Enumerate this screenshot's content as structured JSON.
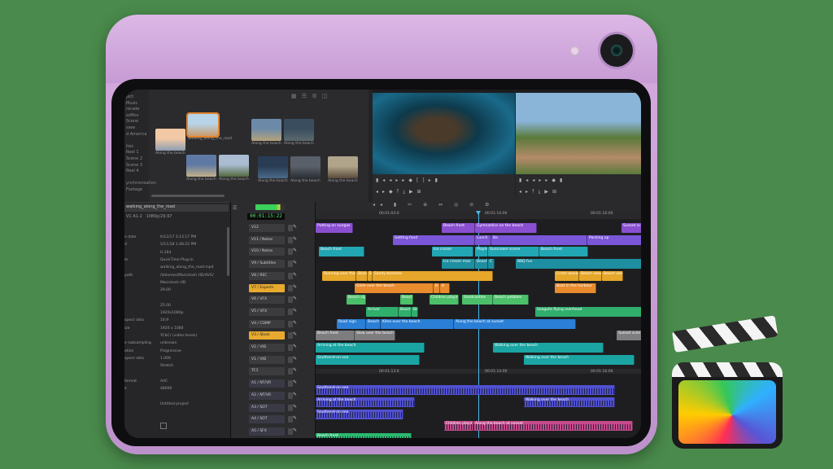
{
  "browser": {
    "bins": [
      "ject",
      "Music",
      "rerade",
      "ssMov",
      "Scene",
      "ssee",
      "d America",
      "",
      "ites",
      "Reel 1",
      "Scene 2",
      "Scene 3",
      "Reel 4",
      "",
      "ynchronization",
      "Footage"
    ],
    "clips": [
      {
        "label": "Along the beach",
        "colors": [
          "#f2c9a4",
          "#8a9db2"
        ]
      },
      {
        "label": "walking_along_the_road",
        "colors": [
          "#b8d4e8",
          "#c99a6a"
        ],
        "selected": true
      },
      {
        "label": "Along the beach",
        "colors": [
          "#6c8aa8",
          "#b5a37a"
        ]
      },
      {
        "label": "Along the beach",
        "colors": [
          "#3a4d5e",
          "#5a6a6e"
        ]
      },
      {
        "label": "Along the beach",
        "colors": [
          "#8a9ab0",
          "#5a4a3a"
        ]
      },
      {
        "label": "Along the beach",
        "colors": [
          "#5e7aa4",
          "#c4b08a"
        ]
      },
      {
        "label": "Along the beach",
        "colors": [
          "#a9bcd2",
          "#546a3e"
        ]
      },
      {
        "label": "Along the beach",
        "colors": [
          "#2a3c54",
          "#4a6a8a"
        ]
      },
      {
        "label": "Along the beach",
        "colors": [
          "#59606a",
          "#2a2e34"
        ]
      },
      {
        "label": "Along the beach",
        "colors": [
          "#b0a58a",
          "#5a4a3a"
        ]
      }
    ]
  },
  "inspector": {
    "clip_name": "walking_along_the_road",
    "subtitle": "V1 A1-2",
    "format": "1080p/29.97",
    "rows": [
      {
        "k": "n date",
        "v": "6/12/17    3:13:17 PM"
      },
      {
        "k": "d",
        "v": "5/11/18    1:48:22 PM"
      },
      {
        "k": "",
        "v": "H.264"
      },
      {
        "k": "le",
        "v": "QuickTime Plug-in"
      },
      {
        "k": "",
        "v": "walking_along_the_road.mp4"
      },
      {
        "k": "path",
        "v": "/Volumes/Macintosh HD/AVG/"
      },
      {
        "k": "",
        "v": "Macintosh HD"
      },
      {
        "k": "",
        "v": "29.00"
      },
      {
        "k": "",
        "v": ""
      },
      {
        "k": "",
        "v": "25.00"
      },
      {
        "k": "",
        "v": "1920x1080p"
      },
      {
        "k": "spect ratio",
        "v": "16:9"
      },
      {
        "k": "ize",
        "v": "1920 x 1080"
      },
      {
        "k": "",
        "v": "YCbCr (video levels)"
      },
      {
        "k": "e subsampling",
        "v": "unknown"
      },
      {
        "k": "ation",
        "v": "Progressive"
      },
      {
        "k": "spect ratio",
        "v": "1.000"
      },
      {
        "k": "",
        "v": "Stretch"
      },
      {
        "k": "",
        "v": ""
      },
      {
        "k": "format",
        "v": "AAC"
      },
      {
        "k": "e",
        "v": "48000"
      },
      {
        "k": "",
        "v": ""
      },
      {
        "k": "",
        "v": "Untitled project"
      }
    ]
  },
  "timeline": {
    "timecode": "00:01:15:22",
    "ruler_ticks": [
      "00:01:03:0",
      "00:01:14:00",
      "00:01:16:00"
    ],
    "ruler2_ticks": [
      "00:01:13:0",
      "00:01:14:00",
      "00:01:16:00"
    ],
    "tracks": [
      {
        "name": "V12",
        "hl": false
      },
      {
        "name": "V11 / Notes",
        "hl": false
      },
      {
        "name": "V10 / Notes",
        "hl": false
      },
      {
        "name": "V9 / Subtitles",
        "hl": false
      },
      {
        "name": "V8 / REC",
        "hl": false
      },
      {
        "name": "V7 / Experts",
        "hl": true
      },
      {
        "name": "V6 / VFX",
        "hl": false
      },
      {
        "name": "V5 / VFX",
        "hl": false
      },
      {
        "name": "V4 / COMP",
        "hl": false
      },
      {
        "name": "V3 / Stock",
        "hl": true
      },
      {
        "name": "V2 / VID",
        "hl": false
      },
      {
        "name": "V1 / VID",
        "hl": false
      },
      {
        "name": "TC1",
        "hl": false
      },
      {
        "name": "A1 / NT/VR",
        "hl": false,
        "audio": true
      },
      {
        "name": "A2 / NT/VR",
        "hl": false,
        "audio": true
      },
      {
        "name": "A3 / SOT",
        "hl": false,
        "audio": true
      },
      {
        "name": "A4 / SOT",
        "hl": false,
        "audio": true
      },
      {
        "name": "A5 / SFX",
        "hl": false,
        "audio": true
      }
    ],
    "lanes": [
      [
        {
          "s": 0,
          "e": 46,
          "t": "Putting on sungas",
          "c": "#8a4fd1"
        },
        {
          "s": 155,
          "e": 196,
          "t": "Beach front",
          "c": "#8a4fd1"
        },
        {
          "s": 196,
          "e": 272,
          "t": "Gymnastics on the beach",
          "c": "#8a4fd1"
        },
        {
          "s": 376,
          "e": 401,
          "t": "Sunset scre",
          "c": "#8a4fd1"
        }
      ],
      [
        {
          "s": 95,
          "e": 196,
          "t": "Getting food",
          "c": "#7a56d8"
        },
        {
          "s": 196,
          "e": 216,
          "t": "Lunch",
          "c": "#7a56d8"
        },
        {
          "s": 216,
          "e": 334,
          "t": "Ba",
          "c": "#7a56d8"
        },
        {
          "s": 334,
          "e": 401,
          "t": "Packing up",
          "c": "#7a56d8"
        }
      ],
      [
        {
          "s": 4,
          "e": 60,
          "t": "Beach front",
          "c": "#23a6b4"
        },
        {
          "s": 143,
          "e": 194,
          "t": "Ice cream",
          "c": "#23a6b4"
        },
        {
          "s": 196,
          "e": 212,
          "t": "Playing",
          "c": "#23a6b4"
        },
        {
          "s": 212,
          "e": 275,
          "t": "Suncream scene",
          "c": "#23a6b4"
        },
        {
          "s": 275,
          "e": 335,
          "t": "Beach front",
          "c": "#23a6b4"
        }
      ],
      [
        {
          "s": 155,
          "e": 196,
          "t": "Ice cream man",
          "c": "#1e8fa0"
        },
        {
          "s": 196,
          "e": 212,
          "t": "Beach",
          "c": "#1e8fa0"
        },
        {
          "s": 212,
          "e": 220,
          "t": "C",
          "c": "#1e8fa0"
        },
        {
          "s": 246,
          "e": 401,
          "t": "BBQ fun",
          "c": "#1e8fa0"
        }
      ],
      [
        {
          "s": 8,
          "e": 50,
          "t": "Running over the s",
          "c": "#e6a72a"
        },
        {
          "s": 50,
          "e": 64,
          "t": "Beach",
          "c": "#e6a72a"
        },
        {
          "s": 64,
          "e": 70,
          "t": "B",
          "c": "#e6a72a"
        },
        {
          "s": 70,
          "e": 218,
          "t": "Sandy beaches",
          "c": "#e6a72a"
        },
        {
          "s": 294,
          "e": 324,
          "t": "Crash waves",
          "c": "#e6a72a"
        },
        {
          "s": 324,
          "e": 352,
          "t": "Beach view",
          "c": "#e6a72a"
        },
        {
          "s": 352,
          "e": 378,
          "t": "Beach view",
          "c": "#e6a72a"
        }
      ],
      [
        {
          "s": 48,
          "e": 145,
          "t": "Glide over the beach",
          "c": "#e88c2e"
        },
        {
          "s": 145,
          "e": 153,
          "t": "B",
          "c": "#e88c2e"
        },
        {
          "s": 153,
          "e": 165,
          "t": "B",
          "c": "#e88c2e"
        },
        {
          "s": 294,
          "e": 345,
          "t": "Boat in the harbour",
          "c": "#e88c2e"
        }
      ],
      [
        {
          "s": 38,
          "e": 62,
          "t": "Beach sign",
          "c": "#4cbf6a"
        },
        {
          "s": 104,
          "e": 120,
          "t": "Beach",
          "c": "#4cbf6a"
        },
        {
          "s": 140,
          "e": 176,
          "t": "Children playing",
          "c": "#4cbf6a"
        },
        {
          "s": 180,
          "e": 218,
          "t": "Sandcastles",
          "c": "#4cbf6a"
        },
        {
          "s": 218,
          "e": 262,
          "t": "Beach pebbles",
          "c": "#4cbf6a"
        }
      ],
      [
        {
          "s": 62,
          "e": 102,
          "t": "Arrival",
          "c": "#2fae6c"
        },
        {
          "s": 102,
          "e": 118,
          "t": "Beach",
          "c": "#2fae6c"
        },
        {
          "s": 118,
          "e": 126,
          "t": "Be",
          "c": "#2fae6c"
        },
        {
          "s": 270,
          "e": 401,
          "t": "Seagulls flying overhead",
          "c": "#2fae6c"
        }
      ],
      [
        {
          "s": 26,
          "e": 62,
          "t": "Road sign",
          "c": "#2b7fd6"
        },
        {
          "s": 62,
          "e": 80,
          "t": "Beach",
          "c": "#2b7fd6"
        },
        {
          "s": 80,
          "e": 170,
          "t": "Kites over the beach",
          "c": "#2b7fd6"
        },
        {
          "s": 170,
          "e": 320,
          "t": "Along the beach at sunset",
          "c": "#2b7fd6"
        }
      ],
      [
        {
          "s": 0,
          "e": 48,
          "t": "Beach front",
          "c": "#7d7d80"
        },
        {
          "s": 48,
          "e": 98,
          "t": "Slow over the beach",
          "c": "#7d7d80"
        },
        {
          "s": 370,
          "e": 401,
          "t": "Sunset scen",
          "c": "#7d7d80"
        }
      ],
      [
        {
          "s": 0,
          "e": 134,
          "t": "Arriving at the beach",
          "c": "#1aa5a3"
        },
        {
          "s": 218,
          "e": 354,
          "t": "Walking over the beach",
          "c": "#1aa5a3"
        }
      ],
      [
        {
          "s": 0,
          "e": 128,
          "t": "Southend-on-sea",
          "c": "#1aa5a3"
        },
        {
          "s": 256,
          "e": 392,
          "t": "Walking over the beach",
          "c": "#1aa5a3"
        }
      ],
      [],
      [
        {
          "s": 0,
          "e": 368,
          "t": "Southend-on-sea",
          "c": "#5050d0",
          "a": true
        }
      ],
      [
        {
          "s": 0,
          "e": 122,
          "t": "Arriving at the beach",
          "c": "#5050d0",
          "a": true
        },
        {
          "s": 256,
          "e": 368,
          "t": "Walking over the beach",
          "c": "#5050d0",
          "a": true
        }
      ],
      [
        {
          "s": 0,
          "e": 108,
          "t": "Southend-on-sea",
          "c": "#5050d0",
          "a": true
        }
      ],
      [
        {
          "s": 158,
          "e": 194,
          "t": "Children playing",
          "c": "#c64a8c",
          "a": true
        },
        {
          "s": 194,
          "e": 390,
          "t": "Along the beach at sunset",
          "c": "#c64a8c",
          "a": true
        }
      ],
      [
        {
          "s": 0,
          "e": 118,
          "t": "Beach front",
          "c": "#2ab86e",
          "a": true
        }
      ]
    ]
  },
  "viewers": {
    "source_colors": [
      "#0d3a4c",
      "#4a3a2a",
      "#1a6a8a"
    ],
    "record_colors": [
      "#8ab4d8",
      "#5a7a3a",
      "#b48a6a"
    ]
  }
}
